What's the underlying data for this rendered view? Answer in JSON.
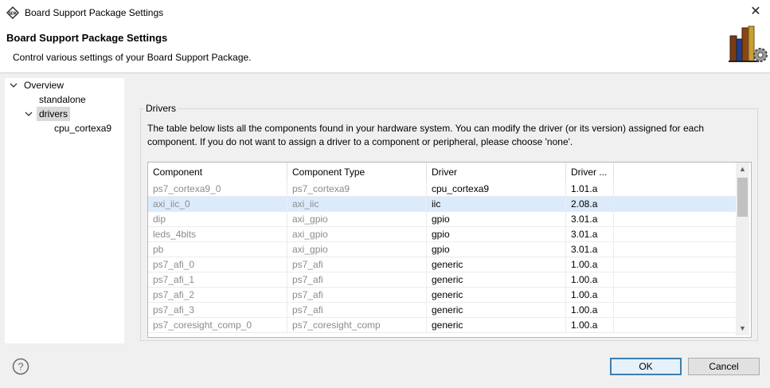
{
  "window": {
    "title": "Board Support Package Settings",
    "close_glyph": "✕"
  },
  "header": {
    "title": "Board Support Package Settings",
    "description": "Control various settings of your Board Support Package."
  },
  "tree": {
    "items": [
      {
        "label": "Overview",
        "expanded": true
      },
      {
        "label": "standalone"
      },
      {
        "label": "drivers",
        "expanded": true,
        "selected": true
      },
      {
        "label": "cpu_cortexa9"
      }
    ]
  },
  "drivers": {
    "group_label": "Drivers",
    "description": "The table below lists all the components found in your hardware system. You can modify the driver (or its version) assigned for each component. If you do not want to assign a driver to a component or peripheral, please choose 'none'.",
    "columns": [
      "Component",
      "Component Type",
      "Driver",
      "Driver ..."
    ],
    "rows": [
      {
        "component": "ps7_cortexa9_0",
        "type": "ps7_cortexa9",
        "driver": "cpu_cortexa9",
        "version": "1.01.a"
      },
      {
        "component": "axi_iic_0",
        "type": "axi_iic",
        "driver": "iic",
        "version": "2.08.a",
        "selected": true
      },
      {
        "component": "dip",
        "type": "axi_gpio",
        "driver": "gpio",
        "version": "3.01.a"
      },
      {
        "component": "leds_4bits",
        "type": "axi_gpio",
        "driver": "gpio",
        "version": "3.01.a"
      },
      {
        "component": "pb",
        "type": "axi_gpio",
        "driver": "gpio",
        "version": "3.01.a"
      },
      {
        "component": "ps7_afi_0",
        "type": "ps7_afi",
        "driver": "generic",
        "version": "1.00.a"
      },
      {
        "component": "ps7_afi_1",
        "type": "ps7_afi",
        "driver": "generic",
        "version": "1.00.a"
      },
      {
        "component": "ps7_afi_2",
        "type": "ps7_afi",
        "driver": "generic",
        "version": "1.00.a"
      },
      {
        "component": "ps7_afi_3",
        "type": "ps7_afi",
        "driver": "generic",
        "version": "1.00.a"
      },
      {
        "component": "ps7_coresight_comp_0",
        "type": "ps7_coresight_comp",
        "driver": "generic",
        "version": "1.00.a"
      }
    ]
  },
  "footer": {
    "ok_label": "OK",
    "cancel_label": "Cancel",
    "help_icon": "help-icon"
  },
  "colors": {
    "selection_row": "#dcebfc",
    "default_button_border": "#3c7fb1",
    "dim_text": "#8c8c8c"
  }
}
